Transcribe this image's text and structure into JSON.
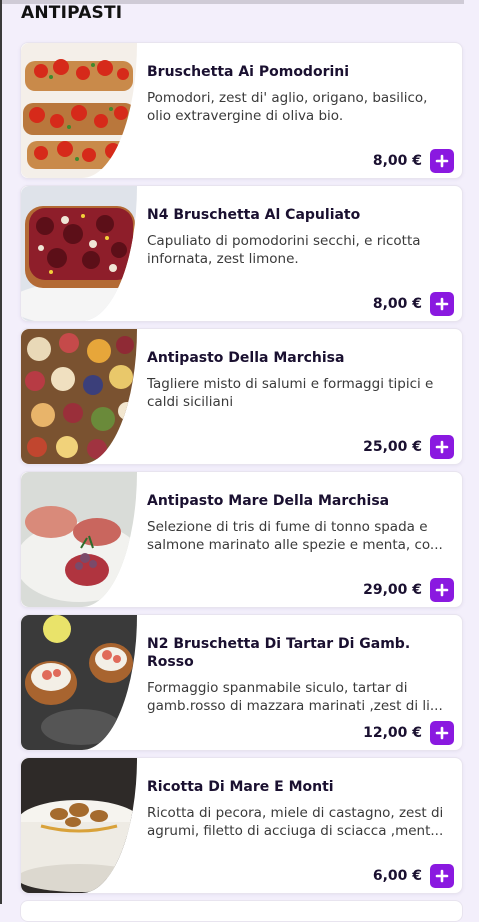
{
  "section": {
    "title": "ANTIPASTI"
  },
  "items": [
    {
      "name": "Bruschetta Ai Pomodorini",
      "description": "Pomodori, zest di' aglio, origano, basilico, olio extravergine di oliva bio.",
      "price": "8,00 €",
      "image": "bruschetta-tomatoes"
    },
    {
      "name": " N4 Bruschetta Al Capuliato",
      "description": "Capuliato di pomodorini secchi, e ricotta infornata, zest limone.",
      "price": "8,00 €",
      "image": "bruschetta-capuliato"
    },
    {
      "name": "Antipasto Della Marchisa",
      "description": "Tagliere misto di salumi e formaggi tipici e caldi siciliani",
      "price": "25,00 €",
      "image": "charcuterie-board"
    },
    {
      "name": "Antipasto Mare Della Marchisa",
      "description": "Selezione di tris di fume di tonno spada e salmone marinato alle spezie e menta, co...",
      "price": "29,00 €",
      "image": "seafood-platter"
    },
    {
      "name": " N2 Bruschetta Di Tartar Di Gamb. Rosso",
      "description": "Formaggio spanmabile siculo, tartar di gamb.rosso di mazzara marinati ,zest di li...",
      "price": "12,00 €",
      "image": "shrimp-tartare-bruschetta"
    },
    {
      "name": "Ricotta Di Mare E Monti",
      "description": "Ricotta di pecora, miele di castagno, zest di agrumi, filetto di acciuga di sciacca ,ment...",
      "price": "6,00 €",
      "image": "ricotta-walnuts"
    }
  ],
  "colors": {
    "accent": "#8a19e0",
    "background": "#f3effb",
    "card": "#ffffff",
    "text": "#1a1030"
  }
}
